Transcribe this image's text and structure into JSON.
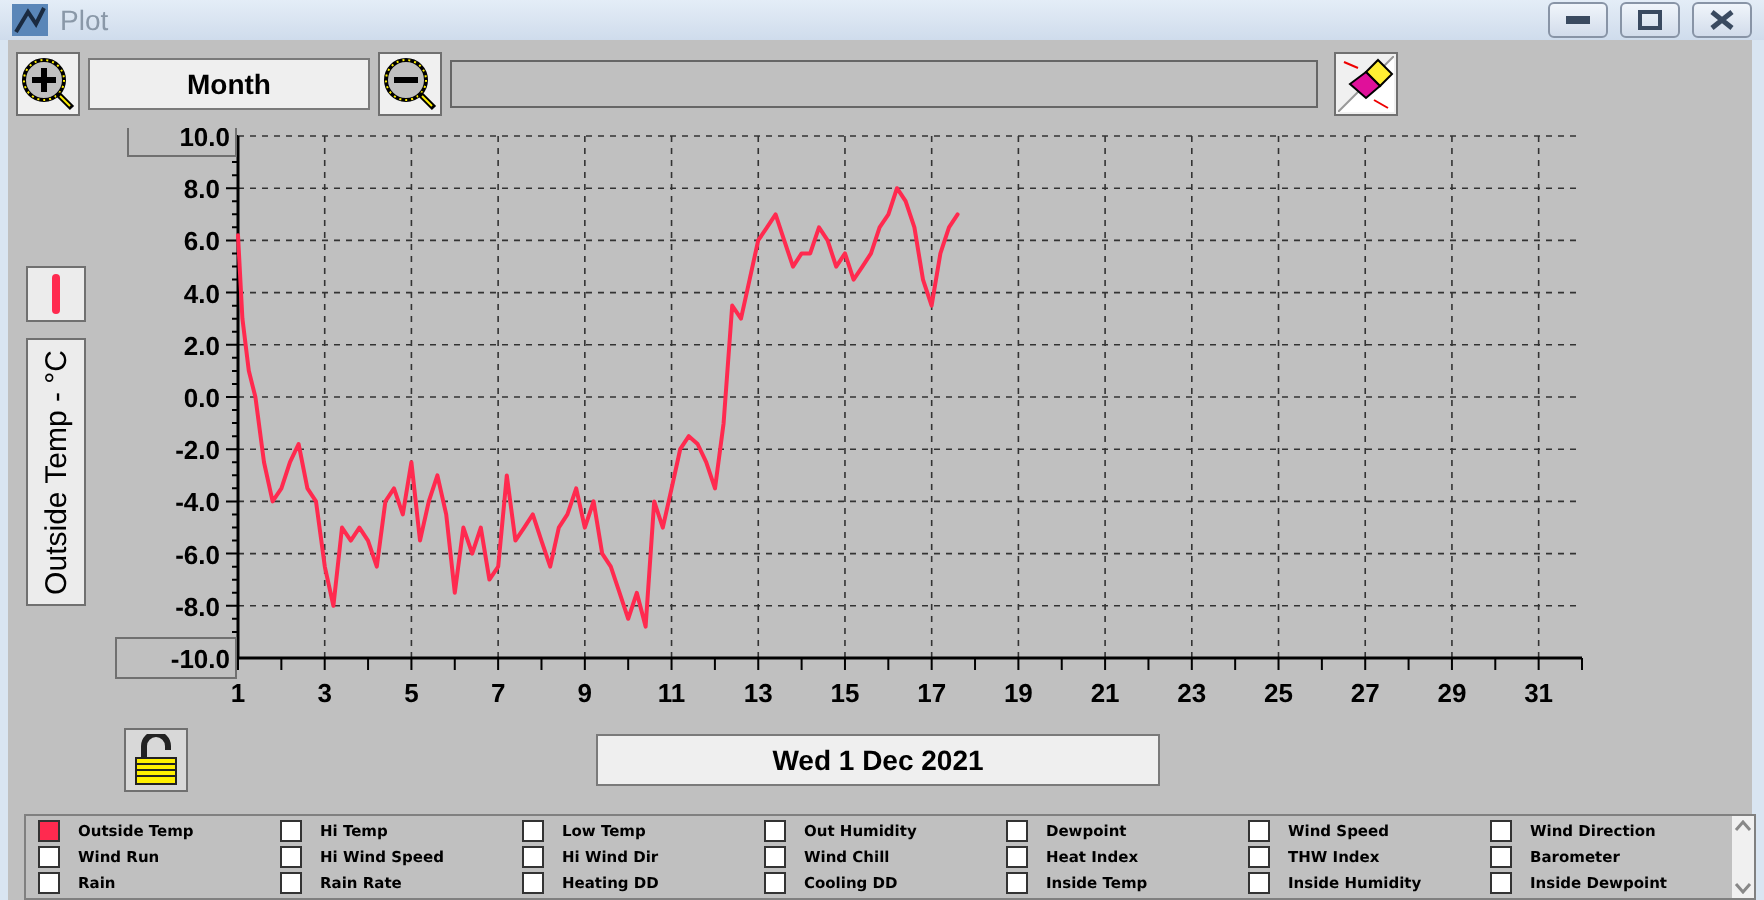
{
  "window": {
    "title": "Plot"
  },
  "toolbar": {
    "range_label": "Month"
  },
  "chart_data": {
    "type": "line",
    "ylabel": "Outside Temp - °C",
    "grid": true,
    "xlim": [
      1,
      32
    ],
    "ylim": [
      -10,
      10
    ],
    "xticks": [
      1,
      3,
      5,
      7,
      9,
      11,
      13,
      15,
      17,
      19,
      21,
      23,
      25,
      27,
      29,
      31
    ],
    "yticks": [
      {
        "value": 10,
        "label": "10.0"
      },
      {
        "value": 8,
        "label": "8.0"
      },
      {
        "value": 6,
        "label": "6.0"
      },
      {
        "value": 4,
        "label": "4.0"
      },
      {
        "value": 2,
        "label": "2.0"
      },
      {
        "value": 0,
        "label": "0.0"
      },
      {
        "value": -2,
        "label": "-2.0"
      },
      {
        "value": -4,
        "label": "-4.0"
      },
      {
        "value": -6,
        "label": "-6.0"
      },
      {
        "value": -8,
        "label": "-8.0"
      },
      {
        "value": -10,
        "label": "-10.0"
      }
    ],
    "x": [
      1,
      1.1,
      1.25,
      1.4,
      1.6,
      1.8,
      2,
      2.2,
      2.4,
      2.6,
      2.8,
      3,
      3.2,
      3.4,
      3.6,
      3.8,
      4,
      4.2,
      4.4,
      4.6,
      4.8,
      5,
      5.2,
      5.4,
      5.6,
      5.8,
      6,
      6.2,
      6.4,
      6.6,
      6.8,
      7,
      7.2,
      7.4,
      7.6,
      7.8,
      8,
      8.2,
      8.4,
      8.6,
      8.8,
      9,
      9.2,
      9.4,
      9.6,
      9.8,
      10,
      10.2,
      10.4,
      10.6,
      10.8,
      11,
      11.2,
      11.4,
      11.6,
      11.8,
      12,
      12.2,
      12.4,
      12.6,
      12.8,
      13,
      13.2,
      13.4,
      13.6,
      13.8,
      14,
      14.2,
      14.4,
      14.6,
      14.8,
      15,
      15.2,
      15.4,
      15.6,
      15.8,
      16,
      16.2,
      16.4,
      16.6,
      16.8,
      17,
      17.2,
      17.4,
      17.6
    ],
    "series": [
      {
        "color": "#ff2a4f",
        "values": [
          6.2,
          3,
          1,
          0,
          -2.5,
          -4,
          -3.5,
          -2.5,
          -1.8,
          -3.5,
          -4,
          -6.5,
          -8,
          -5,
          -5.5,
          -5,
          -5.5,
          -6.5,
          -4,
          -3.5,
          -4.5,
          -2.5,
          -5.5,
          -4,
          -3,
          -4.5,
          -7.5,
          -5,
          -6,
          -5,
          -7,
          -6.5,
          -3,
          -5.5,
          -5,
          -4.5,
          -5.5,
          -6.5,
          -5,
          -4.5,
          -3.5,
          -5,
          -4,
          -6,
          -6.5,
          -7.5,
          -8.5,
          -7.5,
          -8.8,
          -4,
          -5,
          -3.5,
          -2,
          -1.5,
          -1.8,
          -2.5,
          -3.5,
          -1,
          3.5,
          3,
          4.5,
          6,
          6.5,
          7,
          6,
          5,
          5.5,
          5.5,
          6.5,
          6,
          5,
          5.5,
          4.5,
          5,
          5.5,
          6.5,
          7,
          8,
          7.5,
          6.5,
          4.5,
          3.5,
          5.5,
          6.5,
          7
        ]
      }
    ]
  },
  "date_button": "Wed 1 Dec 2021",
  "legend": [
    {
      "label": "Outside Temp",
      "checked": true
    },
    {
      "label": "Hi Temp",
      "checked": false
    },
    {
      "label": "Low Temp",
      "checked": false
    },
    {
      "label": "Out Humidity",
      "checked": false
    },
    {
      "label": "Dewpoint",
      "checked": false
    },
    {
      "label": "Wind Speed",
      "checked": false
    },
    {
      "label": "Wind Direction",
      "checked": false
    },
    {
      "label": "Wind Run",
      "checked": false
    },
    {
      "label": "Hi Wind Speed",
      "checked": false
    },
    {
      "label": "Hi Wind Dir",
      "checked": false
    },
    {
      "label": "Wind Chill",
      "checked": false
    },
    {
      "label": "Heat Index",
      "checked": false
    },
    {
      "label": "THW Index",
      "checked": false
    },
    {
      "label": "Barometer",
      "checked": false
    },
    {
      "label": "Rain",
      "checked": false
    },
    {
      "label": "Rain Rate",
      "checked": false
    },
    {
      "label": "Heating DD",
      "checked": false
    },
    {
      "label": "Cooling DD",
      "checked": false
    },
    {
      "label": "Inside Temp",
      "checked": false
    },
    {
      "label": "Inside Humidity",
      "checked": false
    },
    {
      "label": "Inside Dewpoint",
      "checked": false
    }
  ]
}
